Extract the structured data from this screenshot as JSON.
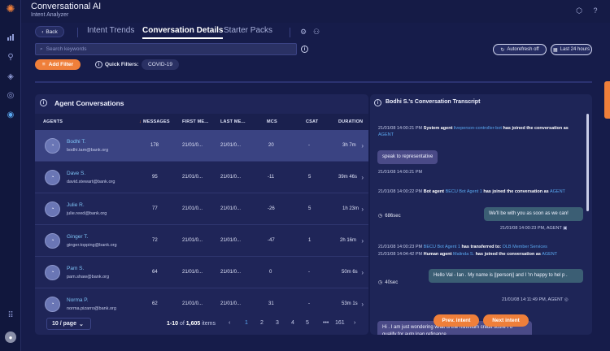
{
  "app": {
    "title": "Conversational AI",
    "subtitle": "Intent Analyzer"
  },
  "nav": {
    "back_label": "Back",
    "tabs": [
      "Intent Trends",
      "Conversation Details",
      "Starter Packs"
    ],
    "active_tab": "Conversation Details"
  },
  "search": {
    "placeholder": "Search keywords"
  },
  "toolbar": {
    "autorefresh_label": "Autorefresh off",
    "timerange_label": "Last 24 hours",
    "add_filter_label": "Add Filter",
    "quick_filters_label": "Quick Filters:",
    "quick_filter_chip": "COVID-19"
  },
  "agents": {
    "title": "Agent Conversations",
    "columns": [
      "AGENTS",
      "MESSAGES",
      "FIRST ME...",
      "LAST ME...",
      "MCS",
      "CSAT",
      "DURATION"
    ],
    "rows": [
      {
        "name": "Bodhi T.",
        "email": "bodhi.tam@bank.org",
        "messages": "178",
        "first": "21/01/0...",
        "last": "21/01/0...",
        "mcs": "20",
        "csat": "-",
        "duration": "3h 7m"
      },
      {
        "name": "Dave S.",
        "email": "david.stewart@bank.org",
        "messages": "95",
        "first": "21/01/0...",
        "last": "21/01/0...",
        "mcs": "-11",
        "csat": "5",
        "duration": "39m 46s"
      },
      {
        "name": "Julie R.",
        "email": "julie.reed@bank.org",
        "messages": "77",
        "first": "21/01/0...",
        "last": "21/01/0...",
        "mcs": "-26",
        "csat": "5",
        "duration": "1h 23m"
      },
      {
        "name": "Ginger T.",
        "email": "ginger.topping@bank.org",
        "messages": "72",
        "first": "21/01/0...",
        "last": "21/01/0...",
        "mcs": "-47",
        "csat": "1",
        "duration": "2h 16m"
      },
      {
        "name": "Pam S.",
        "email": "pam.shaw@bank.org",
        "messages": "64",
        "first": "21/01/0...",
        "last": "21/01/0...",
        "mcs": "0",
        "csat": "-",
        "duration": "50m 6s"
      },
      {
        "name": "Norma P.",
        "email": "norma.pizarro@bank.org",
        "messages": "62",
        "first": "21/01/0...",
        "last": "21/01/0...",
        "mcs": "31",
        "csat": "-",
        "duration": "53m 1s"
      }
    ],
    "page_size": "10 / page",
    "range": "1-10",
    "of_word": "of",
    "total": "1,605",
    "items_word": "items",
    "pages": [
      "1",
      "2",
      "3",
      "4",
      "5",
      "•••",
      "161"
    ]
  },
  "transcript": {
    "title": "Bodhi S.'s Conversation Transcript",
    "event1_time": "21/01/08 14:00:21 PM",
    "event1_role": "System agent",
    "event1_actor": "liveperson-controller-bot",
    "event1_text": "has joined the conversation as",
    "event1_agent": "AGENT",
    "msg1": "speak to representative",
    "msg1_time": "21/01/08 14:00:21 PM",
    "event2_time": "21/01/08 14:00:22 PM",
    "event2_role": "Bot agent",
    "event2_actor": "BECU Bot Agent 1",
    "event2_text": "has joined the conversation as",
    "event2_agent": "AGENT",
    "timer1": "686sec",
    "msg2": "We'll be with you as soon as we can!",
    "msg2_time": "21/01/08 14:00:23 PM, AGENT",
    "event3_time": "21/01/08 14:00:23 PM",
    "event3_actor": "BECU Bot Agent 1",
    "event3_text": "has transferred to:",
    "event3_target": "OLB Member Services",
    "event4_time": "21/01/08 14:04:42 PM",
    "event4_role": "Human agent",
    "event4_actor": "Malinda S.",
    "event4_text": "has joined the conversation as",
    "event4_agent": "AGENT",
    "timer2": "40sec",
    "msg3": "Hello Val - Ian . My name is ||person|| and I 'm happy to hel p .",
    "msg3_time": "21/01/08 14:11:49 PM, AGENT",
    "msg4": "Hi . I am just wondering what is the minimum credit score t o qualify for auto loan refinance",
    "prev_label": "Prev. intent",
    "next_label": "Next intent"
  }
}
